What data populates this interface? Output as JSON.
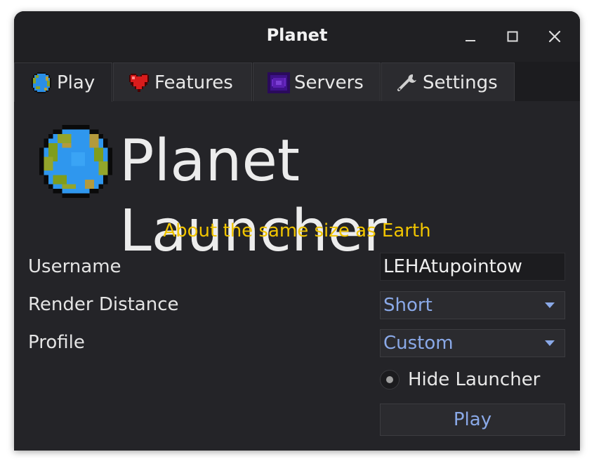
{
  "window": {
    "title": "Planet",
    "controls": [
      "minimize-icon",
      "maximize-icon",
      "close-icon"
    ]
  },
  "tabs": [
    {
      "label": "Play",
      "icon": "planet-icon",
      "active": true
    },
    {
      "label": "Features",
      "icon": "heart-icon",
      "active": false
    },
    {
      "label": "Servers",
      "icon": "portal-icon",
      "active": false
    },
    {
      "label": "Settings",
      "icon": "wrench-icon",
      "active": false
    }
  ],
  "header": {
    "logo": "planet-logo-icon",
    "title": "Planet Launcher",
    "subtitle": "About the same size as Earth"
  },
  "form": {
    "username_label": "Username",
    "username_value": "LEHAtupointow",
    "render_distance_label": "Render Distance",
    "render_distance_value": "Short",
    "profile_label": "Profile",
    "profile_value": "Custom",
    "hide_launcher_label": "Hide Launcher",
    "play_label": "Play"
  },
  "colors": {
    "background": "#242428",
    "accent_text": "#8aa9e8",
    "subtitle": "#f0c400"
  }
}
